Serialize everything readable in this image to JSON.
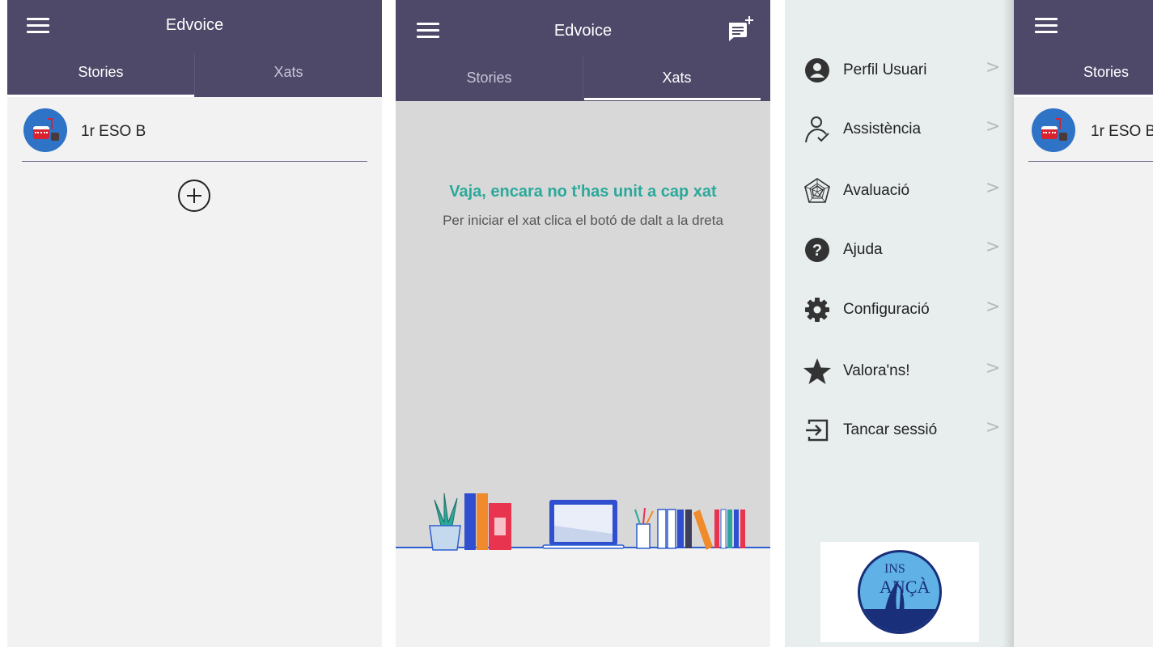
{
  "screen1": {
    "app_title": "Edvoice",
    "tabs": [
      {
        "label": "Stories",
        "active": true
      },
      {
        "label": "Xats",
        "active": false
      }
    ],
    "stories": [
      {
        "label": "1r ESO B"
      }
    ],
    "add_icon": "add-circle-icon"
  },
  "screen2": {
    "app_title": "Edvoice",
    "tabs": [
      {
        "label": "Stories",
        "active": false
      },
      {
        "label": "Xats",
        "active": true
      }
    ],
    "empty_title": "Vaja, encara no t'has unit a cap xat",
    "empty_subtitle": "Per iniciar el xat clica el botó de dalt a la dreta",
    "new_chat_icon": "new-chat-icon"
  },
  "drawer": {
    "items": [
      {
        "label": "Perfil Usuari",
        "icon": "user-circle-icon"
      },
      {
        "label": "Assistència",
        "icon": "person-check-icon"
      },
      {
        "label": "Avaluació",
        "icon": "radar-chart-icon"
      },
      {
        "label": "Ajuda",
        "icon": "help-circle-icon"
      },
      {
        "label": "Configuració",
        "icon": "gear-icon"
      },
      {
        "label": "Valora'ns!",
        "icon": "star-icon"
      },
      {
        "label": "Tancar sessió",
        "icon": "logout-icon"
      }
    ],
    "chevron": ">",
    "logo": {
      "line1": "INS",
      "line2": "ANÇÀ"
    }
  },
  "screen4": {
    "tabs": [
      {
        "label": "Stories",
        "active": true
      }
    ],
    "stories": [
      {
        "label": "1r ESO B"
      }
    ]
  },
  "colors": {
    "appbar": "#4e4869",
    "accent_teal": "#2aa99a",
    "background": "#f2f2f2",
    "drawer_background": "#e8eeee"
  }
}
